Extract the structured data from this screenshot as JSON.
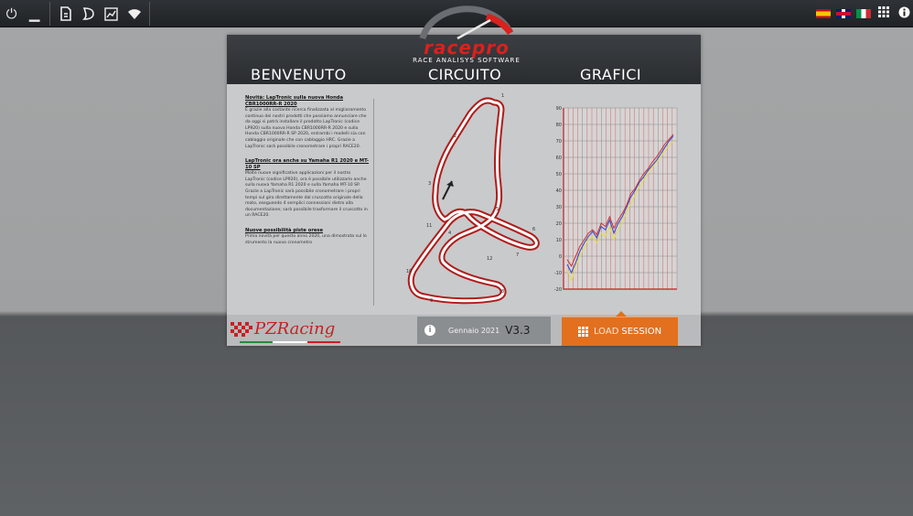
{
  "toolbar": {
    "left_icons": [
      "power-icon",
      "minimize-icon",
      "open-icon",
      "tracks-icon",
      "chart-icon",
      "wifi-icon"
    ],
    "right_icons": [
      "flag-es-icon",
      "flag-uk-icon",
      "flag-it-icon",
      "grid-icon",
      "info-icon"
    ]
  },
  "header": {
    "logo_text": "racepro",
    "logo_subtitle": "RACE ANALISYS SOFTWARE",
    "sections": [
      "BENVENUTO",
      "CIRCUITO",
      "GRAFICI"
    ]
  },
  "news": [
    {
      "title": "Novità: LapTronic sulla nuova Honda CBR1000RR-R 2020",
      "body": "È grazie alla costante ricerca finalizzata al miglioramento continuo dei nostri prodotti che possiamo annunciare che da oggi si potrà installare il prodotto LapTronic (codice LP920) sulla nuova Honda CBR1000RR-R 2020 e sulla Honda CBR1000RR-R SP 2020, entrambi i modelli sia con cablaggio originale che con cablaggio HRC. Grazie a LapTronic sarà possibile cronometrare i propri RACE20."
    },
    {
      "title": "LapTronic ora anche su Yamaha R1 2020 e MT-10 SP",
      "body": "Molte nuove significative applicazioni per il nostro LapTronic (codice LP920), ora è possibile utilizzarlo anche sulla nuova Yamaha R1 2020 e sulla Yamaha MT-10 SP. Grazie a LapTronic sarà possibile cronometrare i propri tempi sul giro direttamente dal cruscotto originale della moto, eseguendo 4 semplici connessioni dietro alla documentazione; sarà possibile trasformare il cruscotto in un RACE20."
    },
    {
      "title": "Nuove possibilità piste orese",
      "body": "Prima novità per questo anno 2020, una dimostrata sul lo strumento la nuovo cronometro"
    }
  ],
  "circuit": {
    "corner_labels": [
      "1",
      "2",
      "3",
      "4",
      "5",
      "6",
      "7",
      "8",
      "9",
      "10",
      "11",
      "12"
    ]
  },
  "chart_data": {
    "type": "line",
    "y_ticks": [
      90,
      80,
      70,
      60,
      50,
      40,
      30,
      20,
      10,
      0,
      -10,
      -20
    ],
    "ylim": [
      -20,
      90
    ],
    "grid": true,
    "series": [
      {
        "color": "#3344cc",
        "values": [
          -5,
          -10,
          -4,
          3,
          8,
          12,
          15,
          11,
          18,
          16,
          22,
          14,
          20,
          24,
          30,
          36,
          40,
          45,
          48,
          52,
          55,
          58,
          62,
          66,
          70,
          73
        ]
      },
      {
        "color": "#e5e040",
        "values": [
          -8,
          -15,
          -6,
          0,
          5,
          10,
          12,
          8,
          14,
          12,
          18,
          10,
          16,
          21,
          27,
          32,
          37,
          42,
          46,
          50,
          54,
          57,
          60,
          64,
          67,
          70
        ]
      },
      {
        "color": "#cc3333",
        "values": [
          -2,
          -6,
          0,
          6,
          10,
          14,
          16,
          13,
          20,
          18,
          24,
          17,
          22,
          26,
          31,
          38,
          41,
          46,
          50,
          53,
          57,
          60,
          64,
          68,
          71,
          74
        ]
      }
    ]
  },
  "sponsor": {
    "name": "PZRacing"
  },
  "footer": {
    "version_date": "Gennaio 2021",
    "version_number": "V3.3",
    "load_prefix": "LOAD",
    "load_suffix": "SESSION"
  },
  "colors": {
    "accent": "#e2701f",
    "brand_red": "#d9211d"
  }
}
